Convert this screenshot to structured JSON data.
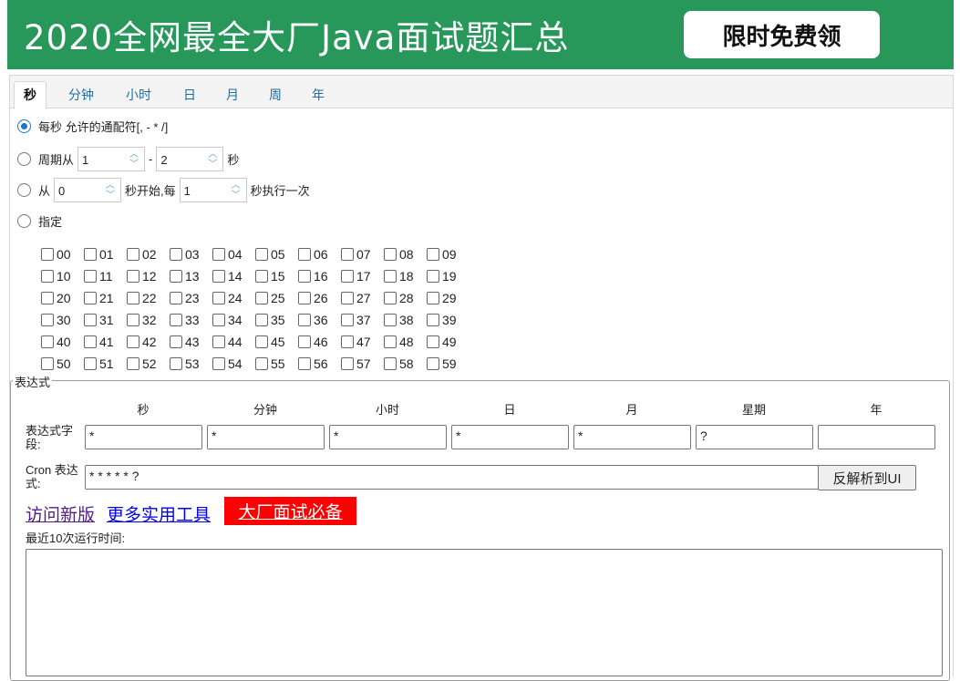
{
  "banner": {
    "title": "2020全网最全大厂Java面试题汇总",
    "button": "限时免费领",
    "color": "#27975a"
  },
  "tabs": [
    "秒",
    "分钟",
    "小时",
    "日",
    "月",
    "周",
    "年"
  ],
  "seconds": {
    "opt_every": "每秒 允许的通配符[, - * /]",
    "opt_cycle_prefix": "周期从",
    "cycle_from": "1",
    "cycle_sep": "-",
    "cycle_to": "2",
    "cycle_suffix": "秒",
    "opt_from_prefix": "从",
    "from_value": "0",
    "from_mid": "秒开始,每",
    "every_value": "1",
    "from_suffix": "秒执行一次",
    "opt_specify": "指定",
    "checkboxes": [
      [
        "00",
        "01",
        "02",
        "03",
        "04",
        "05",
        "06",
        "07",
        "08",
        "09"
      ],
      [
        "10",
        "11",
        "12",
        "13",
        "14",
        "15",
        "16",
        "17",
        "18",
        "19"
      ],
      [
        "20",
        "21",
        "22",
        "23",
        "24",
        "25",
        "26",
        "27",
        "28",
        "29"
      ],
      [
        "30",
        "31",
        "32",
        "33",
        "34",
        "35",
        "36",
        "37",
        "38",
        "39"
      ],
      [
        "40",
        "41",
        "42",
        "43",
        "44",
        "45",
        "46",
        "47",
        "48",
        "49"
      ],
      [
        "50",
        "51",
        "52",
        "53",
        "54",
        "55",
        "56",
        "57",
        "58",
        "59"
      ]
    ]
  },
  "expression": {
    "legend": "表达式",
    "columns": [
      "秒",
      "分钟",
      "小时",
      "日",
      "月",
      "星期",
      "年"
    ],
    "field_label": "表达式字段:",
    "values": [
      "*",
      "*",
      "*",
      "*",
      "*",
      "?",
      ""
    ],
    "cron_label": "Cron 表达式:",
    "cron_value": "* * * * * ?",
    "reverse_button": "反解析到UI"
  },
  "links": {
    "new_version": "访问新版",
    "more_tools": "更多实用工具",
    "interview": "大厂面试必备"
  },
  "recent": {
    "label": "最近10次运行时间:"
  }
}
